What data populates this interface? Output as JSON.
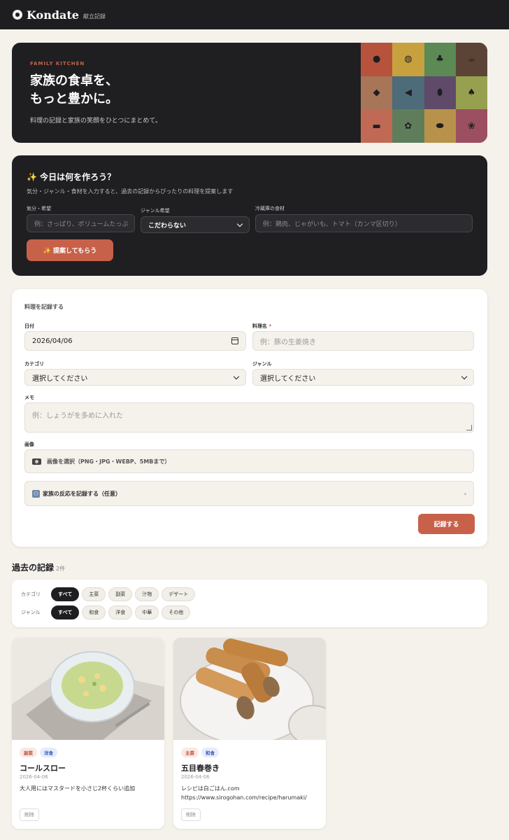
{
  "app": {
    "title": "Kondate",
    "subtitle": "献立記録",
    "accent": "#c8614a",
    "dark": "#1e1e21"
  },
  "hero": {
    "eyebrow": "FAMILY KITCHEN",
    "title_line1": "家族の食卓を、",
    "title_line2": "もっと豊かに。",
    "description": "料理の記録と家族の笑顔をひとつにまとめて。",
    "tiles": [
      "tomato-icon",
      "frying-pan-icon",
      "leafy-vegetable-icon",
      "coffee-icon",
      "meat-icon",
      "fish-icon",
      "eggplant-icon",
      "herb-icon",
      "sushi-icon",
      "broccoli-icon",
      "sweet-potato-icon",
      "flower-icon"
    ]
  },
  "suggest": {
    "title": "✨ 今日は何を作ろう？",
    "description": "気分・ジャンル・食材を入力すると、過去の記録からぴったりの料理を提案します",
    "mood_label": "気分・希望",
    "mood_placeholder": "例：さっぱり、ボリュームたっぷ",
    "genre_label": "ジャンル希望",
    "genre_value": "こだわらない",
    "fridge_label": "冷蔵庫の食材",
    "fridge_placeholder": "例：鶏肉、じゃがいも、トマト（カンマ区切り）",
    "button": "✨ 提案してもらう"
  },
  "form": {
    "title": "料理を記録する",
    "date_label": "日付",
    "date_value": "2026/04/06",
    "name_label": "料理名",
    "required_mark": "*",
    "name_placeholder": "例：豚の生姜焼き",
    "category_label": "カテゴリ",
    "category_value": "選択してください",
    "genre_label": "ジャンル",
    "genre_value": "選択してください",
    "memo_label": "メモ",
    "memo_placeholder": "例：しょうがを多めに入れた",
    "image_label": "画像",
    "image_button": "画像を選択（PNG・JPG・WEBP、5MBまで）",
    "reaction_label": "家族の反応を記録する（任意）",
    "reaction_chevron": "›",
    "submit": "記録する"
  },
  "history": {
    "title": "過去の記録",
    "count": "2件",
    "category_filter_label": "カテゴリ",
    "category_chips": [
      "すべて",
      "主菜",
      "副菜",
      "汁物",
      "デザート"
    ],
    "genre_filter_label": "ジャンル",
    "genre_chips": [
      "すべて",
      "和食",
      "洋食",
      "中華",
      "その他"
    ],
    "records": [
      {
        "category": "副菜",
        "genre": "洋食",
        "name": "コールスロー",
        "date": "2026-04-06",
        "memo_line1": "大人用にはマスタードを小さじ2杯くらい追加",
        "memo_line2": "",
        "delete": "削除"
      },
      {
        "category": "主菜",
        "genre": "和食",
        "name": "五目春巻き",
        "date": "2026-04-06",
        "memo_line1": "レシピは白ごはん.com",
        "memo_line2": "https://www.sirogohan.com/recipe/harumaki/",
        "delete": "削除"
      }
    ]
  }
}
